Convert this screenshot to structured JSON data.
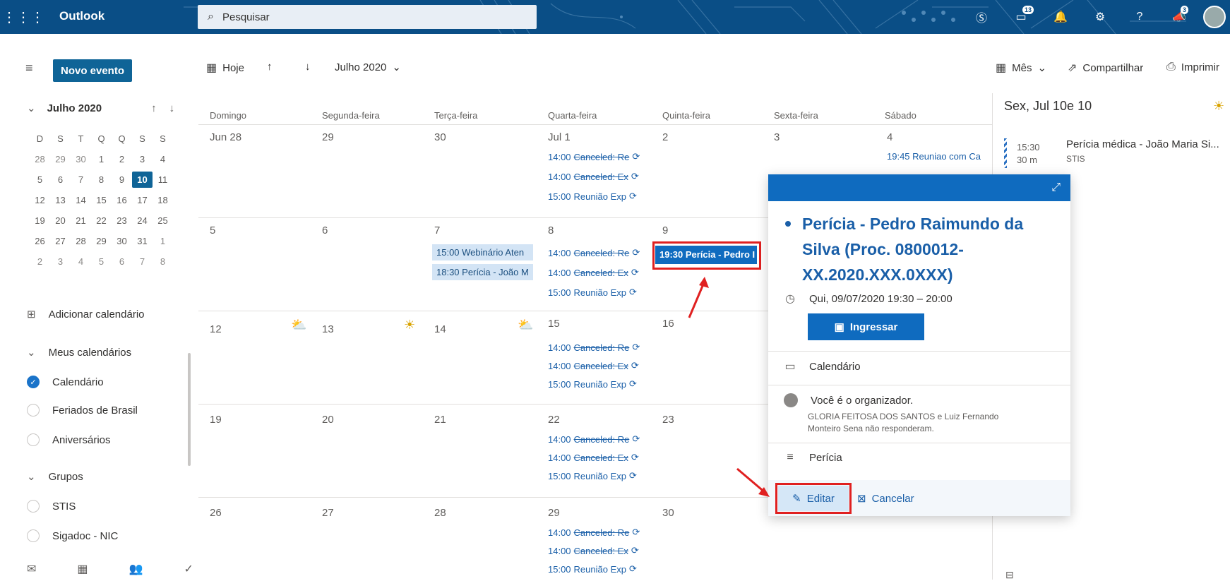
{
  "header": {
    "app_name": "Outlook",
    "search_placeholder": "Pesquisar",
    "chat_badge": "13",
    "notif_badge": "3"
  },
  "toolbar": {
    "new_event": "Novo evento",
    "today": "Hoje",
    "month_label": "Julho 2020",
    "view": "Mês",
    "share": "Compartilhar",
    "print": "Imprimir"
  },
  "mini_calendar": {
    "title": "Julho 2020",
    "weekdays": [
      "D",
      "S",
      "T",
      "Q",
      "Q",
      "S",
      "S"
    ],
    "weeks": [
      [
        "28",
        "29",
        "30",
        "1",
        "2",
        "3",
        "4"
      ],
      [
        "5",
        "6",
        "7",
        "8",
        "9",
        "10",
        "11"
      ],
      [
        "12",
        "13",
        "14",
        "15",
        "16",
        "17",
        "18"
      ],
      [
        "19",
        "20",
        "21",
        "22",
        "23",
        "24",
        "25"
      ],
      [
        "26",
        "27",
        "28",
        "29",
        "30",
        "31",
        "1"
      ],
      [
        "2",
        "3",
        "4",
        "5",
        "6",
        "7",
        "8"
      ]
    ],
    "today": "10"
  },
  "sidebar": {
    "add_calendar": "Adicionar calendário",
    "my_calendars": "Meus calendários",
    "calendars": [
      "Calendário",
      "Feriados de Brasil",
      "Aniversários"
    ],
    "groups_title": "Grupos",
    "groups": [
      "STIS",
      "Sigadoc - NIC"
    ]
  },
  "calendar": {
    "day_headers": [
      "Domingo",
      "Segunda-feira",
      "Terça-feira",
      "Quarta-feira",
      "Quinta-feira",
      "Sexta-feira",
      "Sábado"
    ],
    "weeks": [
      [
        "Jun 28",
        "29",
        "30",
        "Jul 1",
        "2",
        "3",
        "4"
      ],
      [
        "5",
        "6",
        "7",
        "8",
        "9",
        "",
        ""
      ],
      [
        "12",
        "13",
        "14",
        "15",
        "16",
        "",
        ""
      ],
      [
        "19",
        "20",
        "21",
        "22",
        "23",
        "",
        ""
      ],
      [
        "26",
        "27",
        "28",
        "29",
        "30",
        "",
        ""
      ]
    ],
    "recurring": [
      {
        "time": "14:00",
        "title": "Canceled: Re"
      },
      {
        "time": "14:00",
        "title": "Canceled: Ex"
      },
      {
        "time": "15:00",
        "title": "Reunião Exp"
      }
    ],
    "sat_event": "19:45 Reuniao com Ca",
    "tue_events": [
      "15:00 Webinário Aten",
      "18:30 Perícia - João M"
    ],
    "selected_event": "19:30 Perícia - Pedro I"
  },
  "right_pane": {
    "date": "Sex, Jul 10e 10",
    "event_time": "15:30",
    "event_duration": "30 m",
    "event_title": "Perícia médica - João Maria Si...",
    "event_location": "STIS"
  },
  "popup": {
    "title": "Perícia - Pedro Raimundo da Silva (Proc. 0800012-XX.2020.XXX.0XXX)",
    "datetime": "Qui, 09/07/2020 19:30 – 20:00",
    "join": "Ingressar",
    "calendar": "Calendário",
    "organizer": "Você é o organizador.",
    "attendees": "GLORIA FEITOSA DOS SANTOS e Luiz Fernando Monteiro Sena não responderam.",
    "category": "Perícia",
    "edit": "Editar",
    "cancel": "Cancelar"
  },
  "colors": {
    "header_bg": "#0a4e86",
    "accent": "#0f6bbf",
    "highlight": "#e02020"
  }
}
